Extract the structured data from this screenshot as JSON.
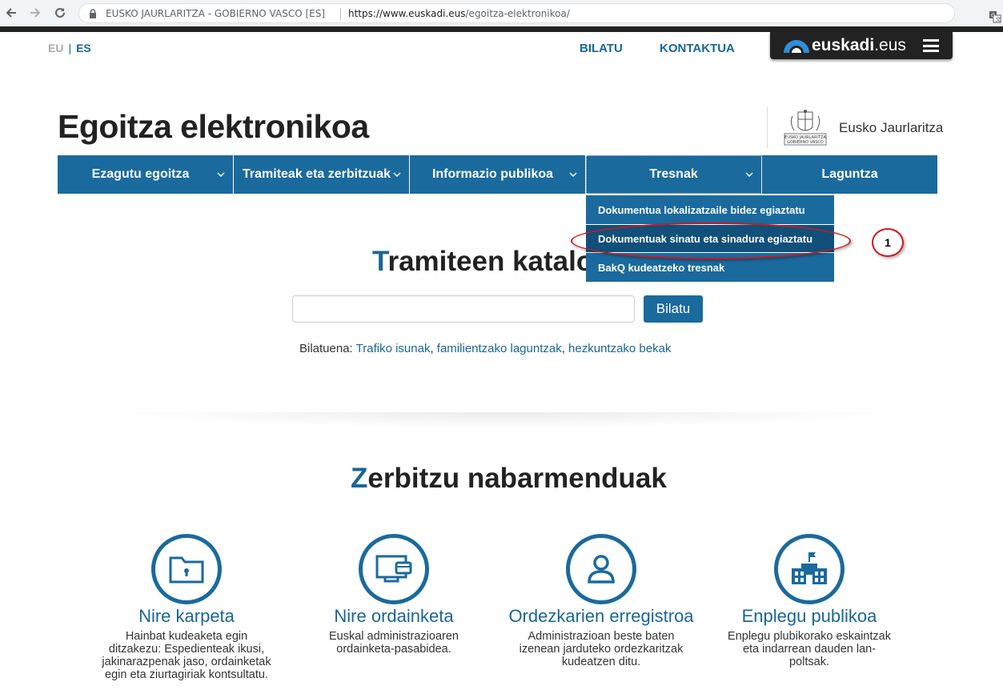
{
  "browser": {
    "site_identity": "EUSKO JAURLARITZA - GOBIERNO VASCO [ES]",
    "url_host": "https://www.euskadi.eus",
    "url_path": "/egoitza-elektronikoa/",
    "icons": [
      "back-arrow-icon",
      "forward-arrow-icon",
      "reload-icon",
      "lock-icon",
      "translate-icon",
      "star-icon"
    ]
  },
  "lang": {
    "eu": "EU",
    "separator": "|",
    "es": "ES"
  },
  "top_links": {
    "search": "BILATU",
    "contact": "KONTAKTUA"
  },
  "portal": {
    "name_bold": "euskadi",
    "name_rest": ".eus"
  },
  "header": {
    "title": "Egoitza elektronikoa",
    "gov_name": "Eusko Jaurlaritza",
    "logo_line1": "EUSKO JAURLARITZA",
    "logo_line2": "GOBIERNO VASCO"
  },
  "nav": {
    "items": [
      {
        "label": "Ezagutu egoitza"
      },
      {
        "label": "Tramiteak eta zerbitzuak"
      },
      {
        "label": "Informazio publikoa"
      },
      {
        "label": "Tresnak"
      },
      {
        "label": "Laguntza"
      }
    ]
  },
  "dropdown": {
    "items": [
      {
        "label": "Dokumentua lokalizatzaile bidez egiaztatu"
      },
      {
        "label": "Dokumentuak sinatu eta sinadura egiaztatu"
      },
      {
        "label": "BakQ kudeatzeko tresnak"
      }
    ]
  },
  "annotation": {
    "number": "1"
  },
  "catalog": {
    "title_first": "T",
    "title_rest": "ramiteen katalogoa",
    "search_value": "",
    "search_button": "Bilatu",
    "popular_label": "Bilatuena:",
    "popular_links": [
      "Trafiko isunak",
      "familientzako laguntzak",
      "hezkuntzako bekak"
    ]
  },
  "services": {
    "title_first": "Z",
    "title_rest": "erbitzu nabarmenduak",
    "items": [
      {
        "title": "Nire karpeta",
        "desc": "Hainbat kudeaketa egin ditzakezu: Espedienteak ikusi, jakinarazpenak jaso, ordainketak egin eta ziurtagiriak kontsultatu.",
        "icon": "folder-lock-icon"
      },
      {
        "title": "Nire ordainketa",
        "desc": "Euskal administrazioaren ordainketa-pasabidea.",
        "icon": "payment-card-icon"
      },
      {
        "title": "Ordezkarien erregistroa",
        "desc": "Administrazioan beste baten izenean jarduteko ordezkaritzak kudeatzen ditu.",
        "icon": "user-icon"
      },
      {
        "title": "Enplegu publikoa",
        "desc": "Enplegu plubikorako eskaintzak eta indarrean dauden lan-poltsak.",
        "icon": "building-icon"
      }
    ]
  },
  "colors": {
    "brand": "#1a6a9e",
    "annotation": "#d0181c",
    "dark": "#222222"
  }
}
